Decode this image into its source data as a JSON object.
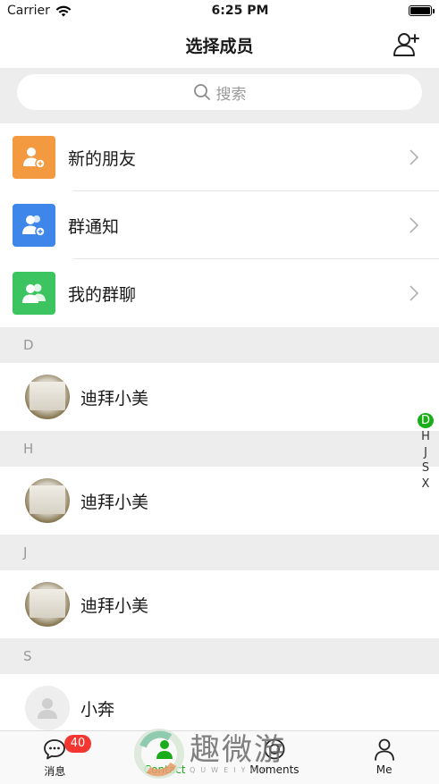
{
  "status_bar": {
    "carrier": "Carrier",
    "time": "6:25 PM"
  },
  "nav": {
    "title": "选择成员",
    "add_icon": "add-person-icon"
  },
  "search": {
    "placeholder": "搜索"
  },
  "functions": [
    {
      "label": "新的朋友",
      "icon": "new-friend-icon",
      "color": "#f3993f"
    },
    {
      "label": "群通知",
      "icon": "group-notice-icon",
      "color": "#3e86e9"
    },
    {
      "label": "我的群聊",
      "icon": "group-chat-icon",
      "color": "#3bc45f"
    }
  ],
  "sections": [
    {
      "letter": "D",
      "contacts": [
        {
          "name": "迪拜小美"
        }
      ]
    },
    {
      "letter": "H",
      "contacts": [
        {
          "name": "迪拜小美"
        }
      ]
    },
    {
      "letter": "J",
      "contacts": [
        {
          "name": "迪拜小美"
        }
      ]
    },
    {
      "letter": "S",
      "contacts": [
        {
          "name": "小奔"
        }
      ]
    }
  ],
  "index_bar": [
    "D",
    "H",
    "J",
    "S",
    "X"
  ],
  "index_active": "D",
  "tab_bar": {
    "tabs": [
      {
        "label": "消息",
        "badge": "40",
        "icon": "message-icon"
      },
      {
        "label": "Contact",
        "icon": "contact-icon",
        "active": true
      },
      {
        "label": "Moments",
        "icon": "moments-icon"
      },
      {
        "label": "Me",
        "icon": "person-icon"
      }
    ]
  },
  "watermark": {
    "title": "趣微游",
    "sub": "QUWEIYOU"
  },
  "colors": {
    "accent": "#1aad19",
    "badge": "#f43530",
    "section_bg": "#ededed"
  }
}
